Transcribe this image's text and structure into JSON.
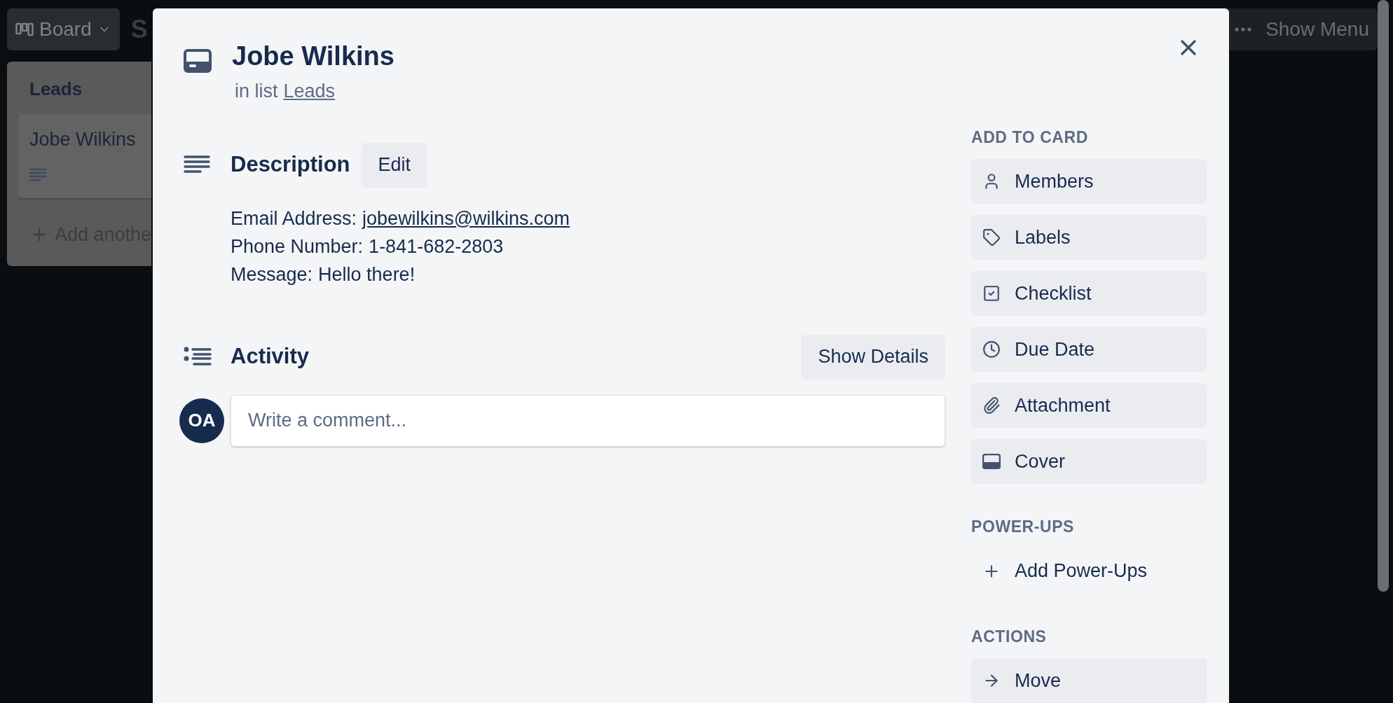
{
  "board_header": {
    "view_button": "Board",
    "board_title": "S",
    "menu_button": "Show Menu"
  },
  "list": {
    "title": "Leads",
    "cards": [
      {
        "title": "Jobe Wilkins"
      }
    ],
    "add_card": "Add anothe"
  },
  "card_modal": {
    "title": "Jobe Wilkins",
    "list_prefix": "in list",
    "list_name": "Leads",
    "description": {
      "heading": "Description",
      "edit_button": "Edit",
      "lines": [
        {
          "label": "Email Address:",
          "value": "jobewilkins@wilkins.com",
          "kind": "link"
        },
        {
          "label": "Phone Number:",
          "value": "1-841-682-2803",
          "kind": "text"
        },
        {
          "label": "Message:",
          "value": "Hello there!",
          "kind": "text"
        }
      ]
    },
    "activity": {
      "heading": "Activity",
      "details_button": "Show Details",
      "avatar_initials": "OA",
      "comment_placeholder": "Write a comment..."
    },
    "sidebar": [
      {
        "heading": "ADD TO CARD",
        "items": [
          {
            "label": "Members",
            "kind": "button"
          },
          {
            "label": "Labels",
            "kind": "button"
          },
          {
            "label": "Checklist",
            "kind": "button"
          },
          {
            "label": "Due Date",
            "kind": "button"
          },
          {
            "label": "Attachment",
            "kind": "button"
          },
          {
            "label": "Cover",
            "kind": "button"
          }
        ]
      },
      {
        "heading": "POWER-UPS",
        "items": [
          {
            "label": "Add Power-Ups",
            "kind": "plain"
          }
        ]
      },
      {
        "heading": "ACTIONS",
        "items": [
          {
            "label": "Move",
            "kind": "button"
          }
        ]
      }
    ]
  }
}
